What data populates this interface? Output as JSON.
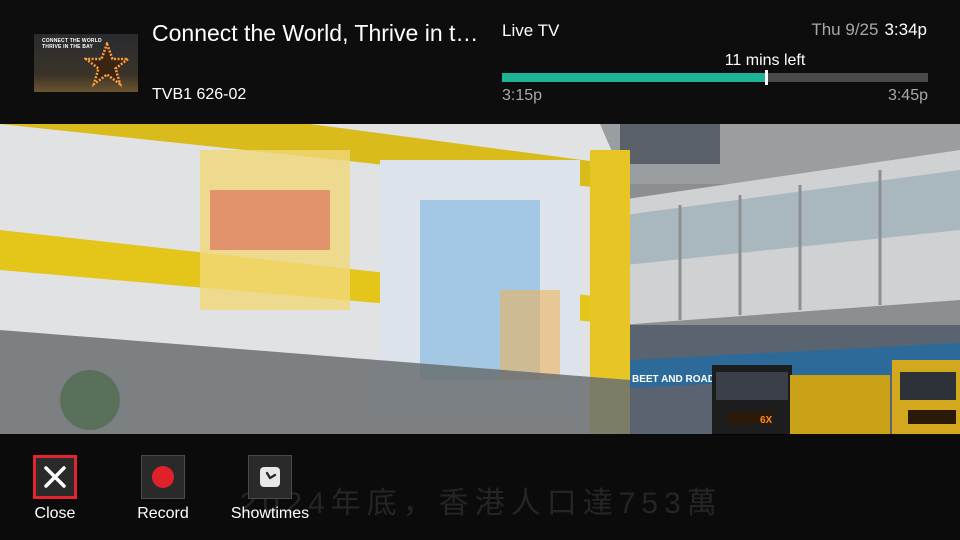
{
  "video": {
    "bus_banner": "BEET AND ROAD",
    "bus_destination": "6X"
  },
  "thumbnail": {
    "line1": "CONNECT THE WORLD",
    "line2": "THRIVE IN THE BAY",
    "icon": "star-icon"
  },
  "program": {
    "title": "Connect the World, Thrive in t…",
    "channel": "TVB1 626-02"
  },
  "status": {
    "source": "Live TV",
    "date": "Thu 9/25",
    "time": "3:34p",
    "remaining": "11 mins left",
    "progress": 0.62,
    "start": "3:15p",
    "end": "3:45p",
    "accent": "#1db397"
  },
  "subtitle": "2024年底，香港人口達753萬",
  "actions": [
    {
      "label": "Close",
      "icon": "close-icon",
      "selected": true
    },
    {
      "label": "Record",
      "icon": "record-icon",
      "selected": false
    },
    {
      "label": "Showtimes",
      "icon": "clock-icon",
      "selected": false
    }
  ]
}
